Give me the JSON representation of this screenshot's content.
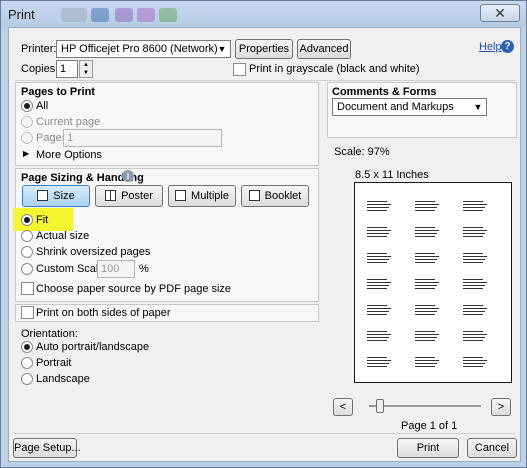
{
  "window": {
    "title": "Print"
  },
  "header": {
    "printer_label": "Printer:",
    "printer_value": "HP Officejet Pro 8600 (Network)",
    "properties_label": "Properties",
    "advanced_label": "Advanced",
    "help_label": "Help",
    "copies_label": "Copies:",
    "copies_value": "1",
    "grayscale_label": "Print in grayscale (black and white)"
  },
  "pages_to_print": {
    "title": "Pages to Print",
    "all": "All",
    "current_page": "Current page",
    "pages": "Pages",
    "pages_value": "1",
    "more_options": "More Options"
  },
  "sizing": {
    "title": "Page Sizing & Handling",
    "tabs": [
      "Size",
      "Poster",
      "Multiple",
      "Booklet"
    ],
    "fit": "Fit",
    "actual_size": "Actual size",
    "shrink": "Shrink oversized pages",
    "custom_scale": "Custom Scale:",
    "custom_scale_value": "100",
    "percent": "%",
    "choose_source": "Choose paper source by PDF page size"
  },
  "both_sides": "Print on both sides of paper",
  "orientation": {
    "title": "Orientation:",
    "auto": "Auto portrait/landscape",
    "portrait": "Portrait",
    "landscape": "Landscape"
  },
  "comments": {
    "title": "Comments & Forms",
    "value": "Document and Markups"
  },
  "preview": {
    "scale": "Scale:  97%",
    "paper": "8.5 x 11 Inches",
    "page_indicator": "Page 1 of 1",
    "prev": "<",
    "next": ">"
  },
  "footer": {
    "page_setup": "Page Setup...",
    "print": "Print",
    "cancel": "Cancel"
  },
  "colors": {
    "highlight": "#f5f530",
    "window": "#bcd0e6"
  }
}
